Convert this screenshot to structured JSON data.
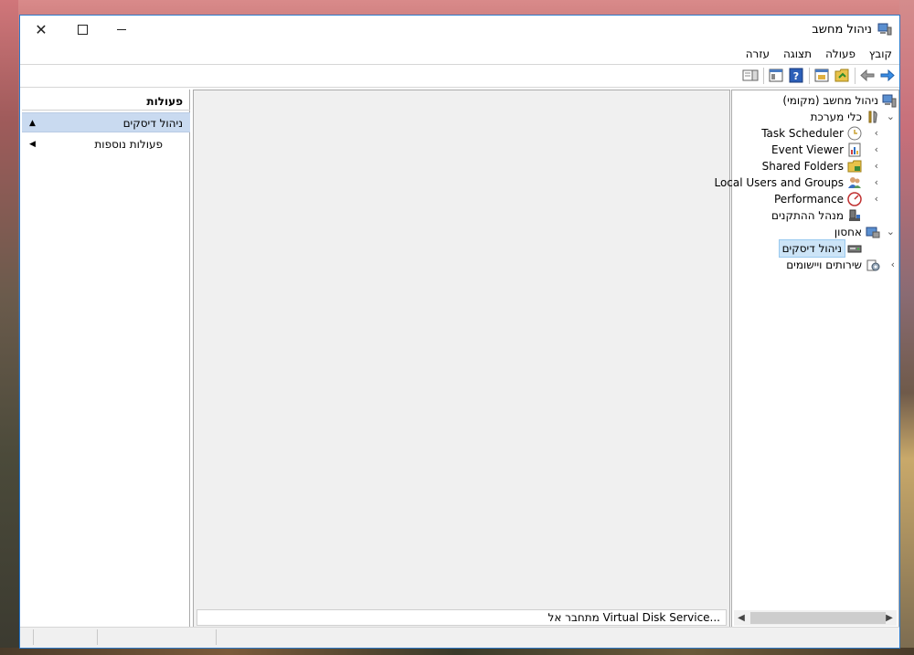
{
  "window": {
    "title": "ניהול מחשב",
    "controls": {
      "close": "✕",
      "maximize": "□",
      "minimize": "—"
    }
  },
  "menu": {
    "file": "קובץ",
    "action": "פעולה",
    "view": "תצוגה",
    "help": "עזרה"
  },
  "toolbar": {
    "icons": [
      "forward-arrow-icon",
      "back-arrow-icon",
      "console-tree-icon",
      "properties-icon",
      "help-icon",
      "view-icon",
      "show-hide-action-pane-icon"
    ]
  },
  "actions_pane": {
    "header": "פעולות",
    "items": [
      {
        "label": "ניהול דיסקים",
        "arrow": "▲",
        "selected": true
      },
      {
        "label": "פעולות נוספות",
        "arrow": "◀",
        "selected": false
      }
    ]
  },
  "center": {
    "status": "מתחבר אל Virtual Disk Service..."
  },
  "tree": {
    "root": "ניהול מחשב (מקומי)",
    "system_tools": "כלי מערכת",
    "task_scheduler": "Task Scheduler",
    "event_viewer": "Event Viewer",
    "shared_folders": "Shared Folders",
    "local_users": "Local Users and Groups",
    "performance": "Performance",
    "device_manager": "מנהל ההתקנים",
    "storage": "אחסון",
    "disk_management": "ניהול דיסקים",
    "services": "שירותים ויישומים"
  },
  "colors": {
    "accent": "#2b78c8",
    "selection": "#c9daf0",
    "tree_selection": "#cce4f7"
  }
}
